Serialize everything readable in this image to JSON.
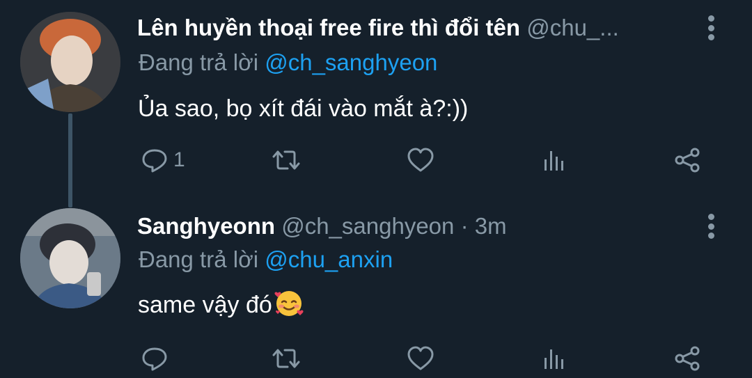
{
  "thread": [
    {
      "display_name": "Lên huyền thoại free fire thì đổi tên",
      "handle": "@chu_...",
      "time": "",
      "replying_prefix": "Đang trả lời",
      "replying_to": "@ch_sanghyeon",
      "text": "Ủa sao, bọ xít đái vào mắt à?:))",
      "reply_count": "1"
    },
    {
      "display_name": "Sanghyeonn",
      "handle": "@ch_sanghyeon",
      "separator": "·",
      "time": "3m",
      "replying_prefix": "Đang trả lời",
      "replying_to": "@chu_anxin",
      "text": "same vậy đó",
      "emoji": "smiling-face-with-hearts",
      "reply_count": ""
    }
  ],
  "icons": {
    "reply": "reply-icon",
    "retweet": "retweet-icon",
    "like": "heart-icon",
    "analytics": "analytics-icon",
    "share": "share-icon",
    "more": "more-vertical-icon"
  },
  "colors": {
    "background": "#15202b",
    "secondary_text": "#8899a6",
    "mention": "#1da1f2",
    "thread_line": "#3d5466"
  }
}
